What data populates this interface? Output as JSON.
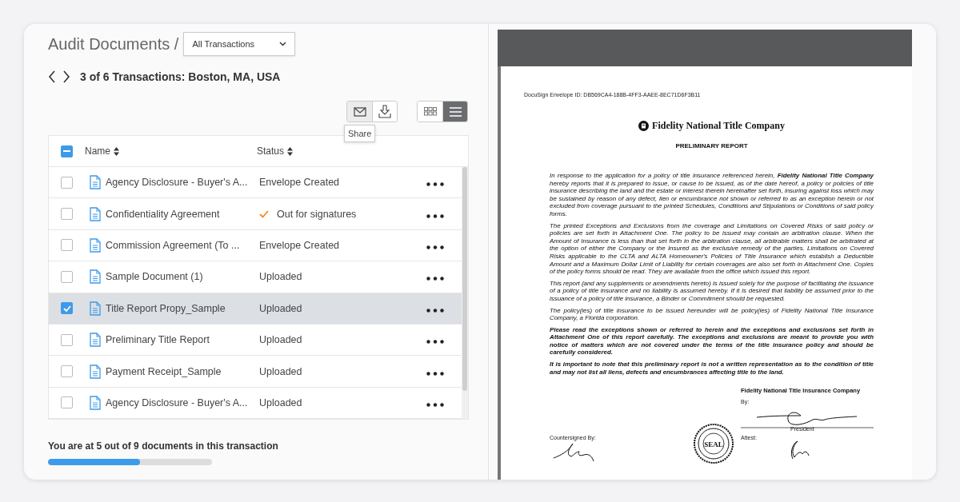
{
  "header": {
    "title": "Audit Documents /",
    "filter": {
      "value": "All Transactions"
    }
  },
  "nav": {
    "label": "3 of 6 Transactions: Boston, MA, USA"
  },
  "toolbar": {
    "tooltip": "Share",
    "views": [
      {
        "kind": "grid",
        "selected": false
      },
      {
        "kind": "list",
        "selected": true
      }
    ]
  },
  "table": {
    "header_checkbox": {
      "indeterminate": true
    },
    "columns": [
      "Name",
      "Status"
    ],
    "rows": [
      {
        "name": "Agency Disclosure - Buyer's A...",
        "status": "Envelope Created",
        "status_check": false,
        "checked": false,
        "selected": false
      },
      {
        "name": "Confidentiality Agreement",
        "status": "Out for signatures",
        "status_check": true,
        "checked": false,
        "selected": false
      },
      {
        "name": "Commission Agreement (To ...",
        "status": "Envelope Created",
        "status_check": false,
        "checked": false,
        "selected": false
      },
      {
        "name": "Sample Document (1)",
        "status": "Uploaded",
        "status_check": false,
        "checked": false,
        "selected": false
      },
      {
        "name": "Title Report Propy_Sample",
        "status": "Uploaded",
        "status_check": false,
        "checked": true,
        "selected": true
      },
      {
        "name": "Preliminary Title Report",
        "status": "Uploaded",
        "status_check": false,
        "checked": false,
        "selected": false
      },
      {
        "name": "Payment Receipt_Sample",
        "status": "Uploaded",
        "status_check": false,
        "checked": false,
        "selected": false
      },
      {
        "name": "Agency Disclosure - Buyer's A...",
        "status": "Uploaded",
        "status_check": false,
        "checked": false,
        "selected": false
      }
    ]
  },
  "progress": {
    "label": "You are at 5 out of 9 documents in this transaction",
    "level": 0.56
  },
  "document": {
    "envelope_id": "DocuSign Envelope ID: DB569CA4-188B-4FF3-AAEE-8EC71D6F3B11",
    "company": "Fidelity National Title Company",
    "title": "PRELIMINARY REPORT",
    "paragraphs": [
      {
        "text": "In response to the application for a policy of title insurance referenced herein, **Fidelity National Title Company** hereby reports that it is prepared to issue, or cause to be issued, as of the date hereof, a policy or policies of title insurance describing the land and the estate or interest therein hereinafter set forth, insuring against loss which may be sustained by reason of any defect, lien or encumbrance not shown or referred to as an exception herein or not excluded from coverage pursuant to the printed Schedules, Conditions and Stipulations or Conditions of said policy forms.",
        "bold": false
      },
      {
        "text": "The printed Exceptions and Exclusions from the coverage and Limitations on Covered Risks of said policy or policies are set forth in Attachment One.  The policy to be issued may contain an arbitration clause.  When the Amount of Insurance is less than that set forth in the arbitration clause, all arbitrable matters shall be arbitrated at the option of either the Company or the Insured as the exclusive remedy of the parties.  Limitations on Covered Risks applicable to the CLTA and ALTA Homeowner's Policies of Title Insurance which establish a Deductible Amount and a Maximum Dollar Limit of Liability for certain coverages are also set forth in Attachment One.  Copies of the policy forms should be read.  They are available from the office which issued this report.",
        "bold": false
      },
      {
        "text": "This report (and any supplements or amendments hereto) is issued solely for the purpose of facilitating the issuance of a policy of title insurance and no liability is assumed hereby.  If it is desired that liability be assumed prior to the issuance of a policy of title insurance, a Binder or Commitment should be requested.",
        "bold": false
      },
      {
        "text": "The policy(ies) of title insurance to be issued hereunder will be policy(ies) of Fidelity National Title Insurance Company, a Florida corporation.",
        "bold": false
      },
      {
        "text": "Please read the exceptions shown or referred to herein and the exceptions and exclusions set forth in Attachment One of this report carefully.  The exceptions and exclusions are meant to provide you with notice of matters which are not covered under the terms of the title insurance policy and should be carefully considered.",
        "bold": true
      },
      {
        "text": "It is important to note that this preliminary report is not a written representation as to the condition of title and may not list all liens, defects and encumbrances affecting title to the land.",
        "bold": true
      }
    ],
    "signature": {
      "company": "Fidelity National Title Insurance Company",
      "by": "By:",
      "role": "President",
      "countersigned": "Countersigned By:",
      "attest": "Attest:",
      "seal": "SEAL"
    }
  }
}
